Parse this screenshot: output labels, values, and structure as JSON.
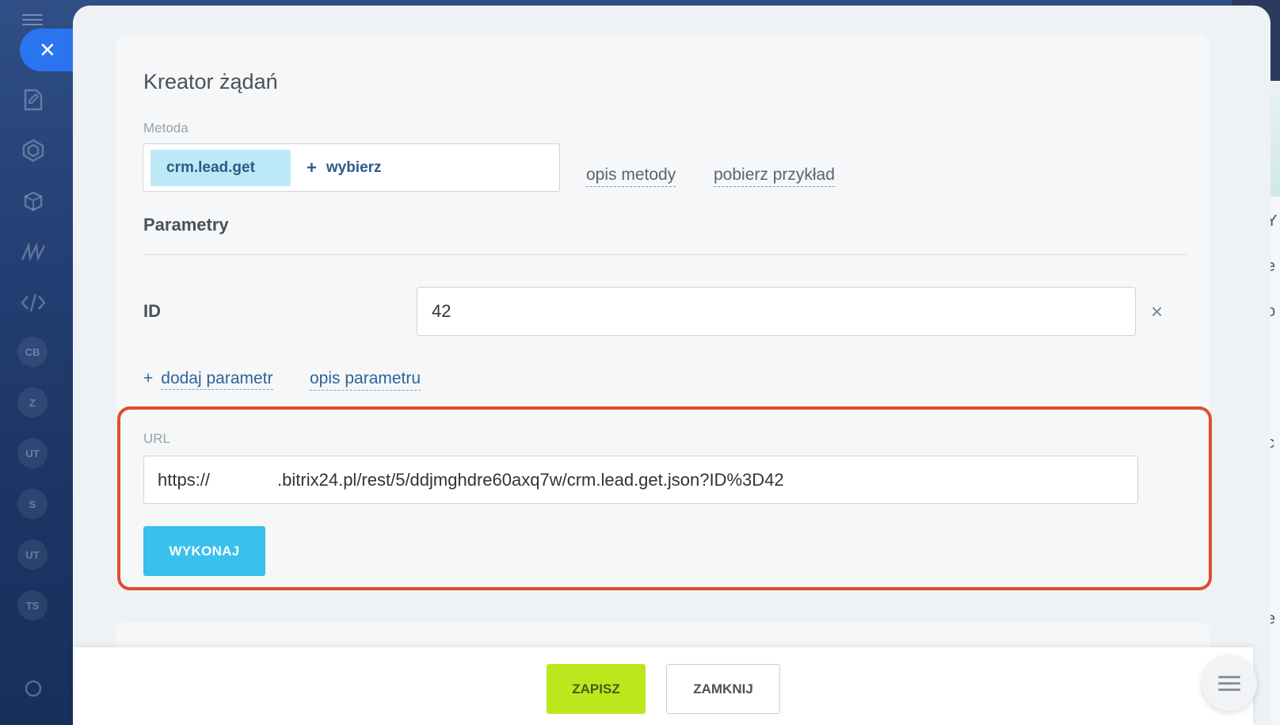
{
  "rail": {
    "badges": [
      "CB",
      "Z",
      "UT",
      "S",
      "UT",
      "TS"
    ]
  },
  "background_strip": {
    "letters": [
      "Y",
      "e",
      "o",
      "c",
      "e"
    ]
  },
  "panel": {
    "title": "Kreator żądań",
    "method": {
      "label": "Metoda",
      "selected": "crm.lead.get",
      "choose_label": "wybierz",
      "choose_icon": "+"
    },
    "links": {
      "method_description": "opis metody",
      "download_example": "pobierz przykład"
    },
    "params": {
      "heading": "Parametry",
      "items": [
        {
          "name": "ID",
          "value": "42"
        }
      ],
      "remove_icon": "×",
      "add_icon": "+",
      "add_label": "dodaj parametr",
      "description_label": "opis parametru"
    },
    "url": {
      "label": "URL",
      "prefix": "https://",
      "rest": ".bitrix24.pl/rest/5/ddjmghdre60axq7w/crm.lead.get.json?ID%3D42"
    },
    "run_button": "WYKONAJ"
  },
  "footer": {
    "save_button": "ZAPISZ",
    "close_button": "ZAMKNIJ"
  },
  "colors": {
    "accent_blue": "#3ac0ec",
    "save_green": "#bbe81c",
    "highlight_red": "#de4f2e",
    "close_pill": "#2a74f0"
  }
}
